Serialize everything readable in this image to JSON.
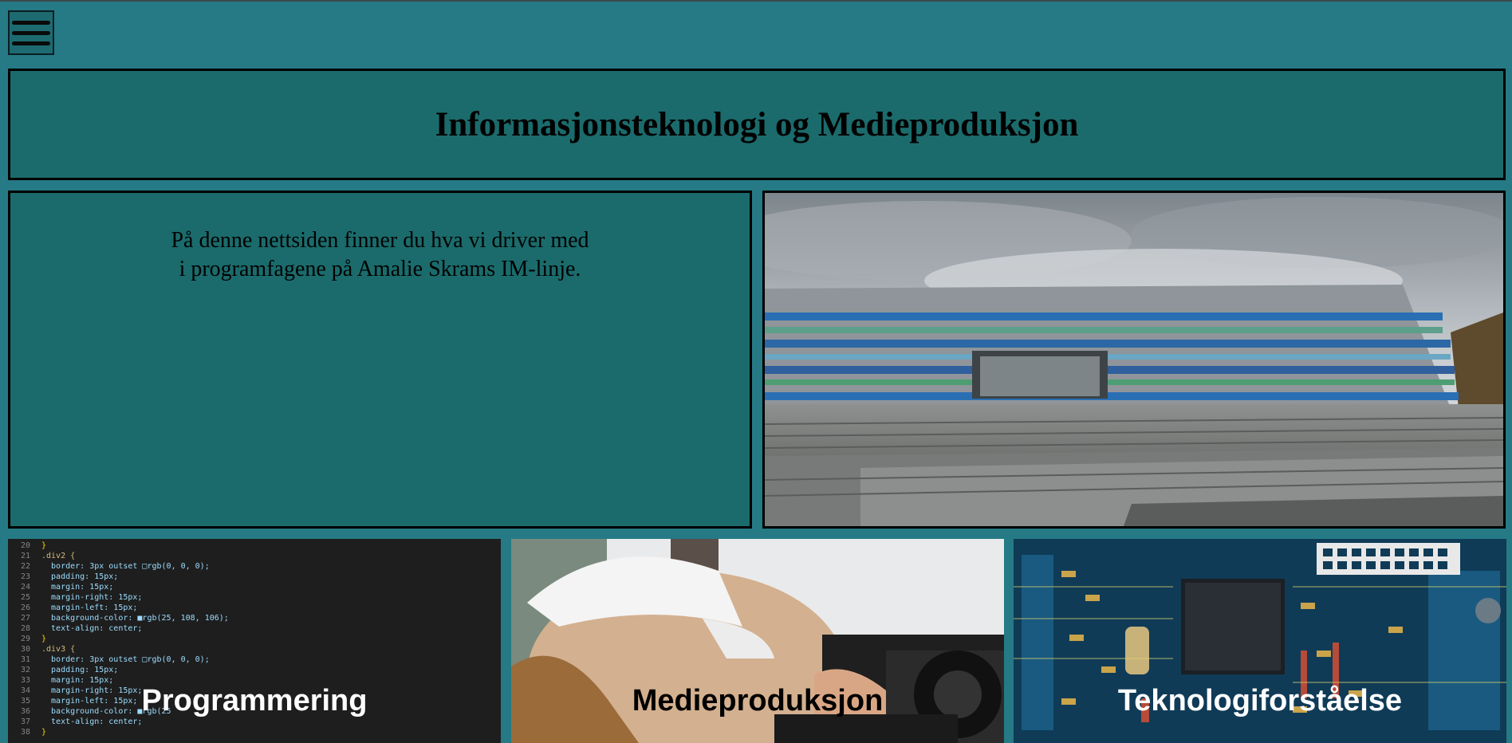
{
  "menu": {
    "icon": "hamburger-menu-icon"
  },
  "header": {
    "title": "Informasjonsteknologi og Medieproduksjon"
  },
  "intro": {
    "line1": "På denne nettsiden finner du hva vi driver med",
    "line2": "i programfagene på Amalie Skrams IM-linje."
  },
  "hero": {
    "image": "school-building-photo"
  },
  "cards": [
    {
      "label": "Programmering",
      "image": "code-editor-screenshot"
    },
    {
      "label": "Medieproduksjon",
      "image": "photographer-with-camera-photo"
    },
    {
      "label": "Teknologiforståelse",
      "image": "circuit-board-photo"
    }
  ],
  "code": {
    "lines": [
      {
        "n": "20",
        "t": "}"
      },
      {
        "n": "21",
        "t": ".div2 {"
      },
      {
        "n": "22",
        "t": "  border: 3px outset □rgb(0, 0, 0);"
      },
      {
        "n": "23",
        "t": "  padding: 15px;"
      },
      {
        "n": "24",
        "t": "  margin: 15px;"
      },
      {
        "n": "25",
        "t": "  margin-right: 15px;"
      },
      {
        "n": "26",
        "t": "  margin-left: 15px;"
      },
      {
        "n": "27",
        "t": "  background-color: ■rgb(25, 108, 106);"
      },
      {
        "n": "28",
        "t": "  text-align: center;"
      },
      {
        "n": "29",
        "t": "}"
      },
      {
        "n": "30",
        "t": ".div3 {"
      },
      {
        "n": "31",
        "t": "  border: 3px outset □rgb(0, 0, 0);"
      },
      {
        "n": "32",
        "t": "  padding: 15px;"
      },
      {
        "n": "33",
        "t": "  margin: 15px;"
      },
      {
        "n": "34",
        "t": "  margin-right: 15px;"
      },
      {
        "n": "35",
        "t": "  margin-left: 15px;"
      },
      {
        "n": "36",
        "t": "  background-color: ■rgb(25"
      },
      {
        "n": "37",
        "t": "  text-align: center;"
      },
      {
        "n": "38",
        "t": "}"
      }
    ]
  },
  "colors": {
    "page_bg": "#257a85",
    "panel_bg": "#1b6b6c",
    "border": "#000000"
  }
}
